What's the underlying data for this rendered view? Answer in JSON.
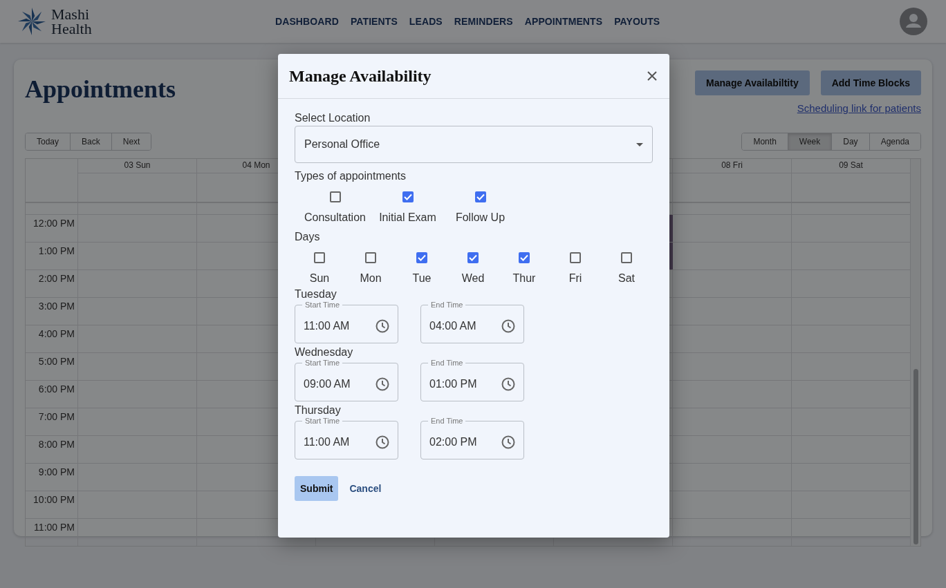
{
  "header": {
    "logo_lines": [
      "Mashi",
      "Health"
    ],
    "nav": [
      "DASHBOARD",
      "PATIENTS",
      "LEADS",
      "REMINDERS",
      "APPOINTMENTS",
      "PAYOUTS"
    ]
  },
  "page": {
    "title": "Appointments",
    "actions": [
      "Manage Availabiltity",
      "Add Time Blocks"
    ],
    "link": "Scheduling link for patients",
    "nav_buttons": [
      "Today",
      "Back",
      "Next"
    ],
    "views": [
      {
        "label": "Month",
        "selected": false
      },
      {
        "label": "Week",
        "selected": true
      },
      {
        "label": "Day",
        "selected": false
      },
      {
        "label": "Agenda",
        "selected": false
      }
    ],
    "calendar": {
      "day_headers": [
        "03 Sun",
        "04 Mon",
        "08 Fri",
        "09 Sat"
      ],
      "time_labels": [
        "12:00 PM",
        "1:00 PM",
        "2:00 PM",
        "3:00 PM",
        "4:00 PM",
        "5:00 PM",
        "6:00 PM",
        "7:00 PM",
        "8:00 PM",
        "9:00 PM",
        "10:00 PM",
        "11:00 PM"
      ]
    }
  },
  "modal": {
    "title": "Manage Availability",
    "location": {
      "label": "Select Location",
      "value": "Personal Office"
    },
    "types_label": "Types of appointments",
    "types": [
      {
        "label": "Consultation",
        "checked": false
      },
      {
        "label": "Initial Exam",
        "checked": true
      },
      {
        "label": "Follow Up",
        "checked": true
      }
    ],
    "days_label": "Days",
    "days": [
      {
        "label": "Sun",
        "checked": false
      },
      {
        "label": "Mon",
        "checked": false
      },
      {
        "label": "Tue",
        "checked": true
      },
      {
        "label": "Wed",
        "checked": true
      },
      {
        "label": "Thur",
        "checked": true
      },
      {
        "label": "Fri",
        "checked": false
      },
      {
        "label": "Sat",
        "checked": false
      }
    ],
    "schedules": [
      {
        "day": "Tuesday",
        "start": {
          "label": "Start Time",
          "value": "11:00 AM"
        },
        "end": {
          "label": "End Time",
          "value": "04:00 AM"
        }
      },
      {
        "day": "Wednesday",
        "start": {
          "label": "Start Time",
          "value": "09:00 AM"
        },
        "end": {
          "label": "End Time",
          "value": "01:00 PM"
        }
      },
      {
        "day": "Thursday",
        "start": {
          "label": "Start Time",
          "value": "11:00 AM"
        },
        "end": {
          "label": "End Time",
          "value": "02:00 PM"
        }
      }
    ],
    "submit": "Submit",
    "cancel": "Cancel"
  }
}
